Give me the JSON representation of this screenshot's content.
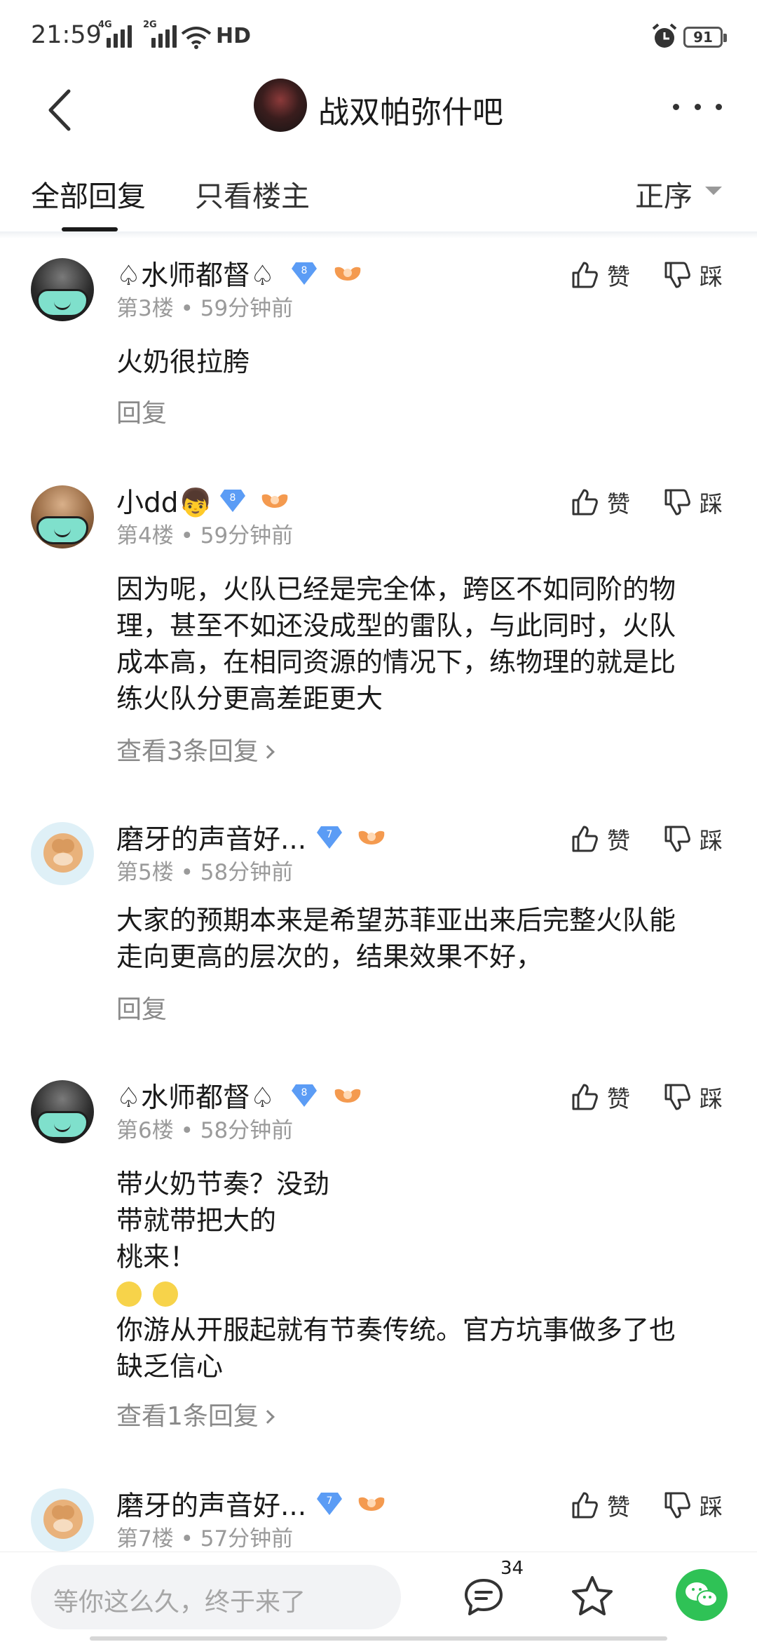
{
  "status": {
    "time": "21:59",
    "net1": "4G",
    "net2": "2G",
    "hd": "HD",
    "battery": "91"
  },
  "header": {
    "forum_title": "战双帕弥什吧"
  },
  "tabs": {
    "all": "全部回复",
    "owner": "只看楼主",
    "sort": "正序"
  },
  "labels": {
    "like": "赞",
    "dislike": "踩",
    "reply": "回复"
  },
  "posts": [
    {
      "username": "♤水师都督♤",
      "level": "8",
      "floor": "第3楼",
      "time": "59分钟前",
      "lines": [
        "火奶很拉胯"
      ],
      "footer": "回复"
    },
    {
      "username": "小dd👦",
      "level": "8",
      "floor": "第4楼",
      "time": "59分钟前",
      "lines": [
        "因为呢，火队已经是完全体，跨区不如同阶的物",
        "理，甚至不如还没成型的雷队，与此同时，火队",
        "成本高，在相同资源的情况下，练物理的就是比",
        "练火队分更高差距更大"
      ],
      "footer": "查看3条回复"
    },
    {
      "username": "磨牙的声音好...",
      "level": "7",
      "floor": "第5楼",
      "time": "58分钟前",
      "lines": [
        "大家的预期本来是希望苏菲亚出来后完整火队能",
        "走向更高的层次的，结果效果不好，"
      ],
      "footer": "回复"
    },
    {
      "username": "♤水师都督♤",
      "level": "8",
      "floor": "第6楼",
      "time": "58分钟前",
      "lines": [
        "带火奶节奏？没劲",
        "带就带把大的",
        "桃来！",
        "你游从开服起就有节奏传统。官方坑事做多了也",
        "缺乏信心"
      ],
      "footer": "查看1条回复"
    },
    {
      "username": "磨牙的声音好...",
      "level": "7",
      "floor": "第7楼",
      "time": "57分钟前"
    }
  ],
  "bottom": {
    "placeholder": "等你这么久，终于来了",
    "comment_count": "34"
  },
  "colors": {
    "accent": "#4a90e2",
    "wechat": "#2fc256",
    "meta": "#9a9a9a"
  }
}
